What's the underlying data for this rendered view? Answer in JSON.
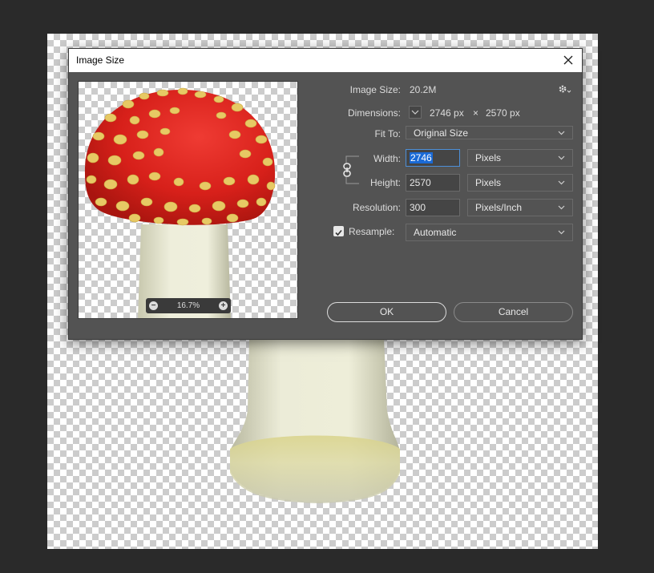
{
  "dialog": {
    "title": "Image Size",
    "image_size_label": "Image Size:",
    "image_size_value": "20.2M",
    "dimensions_label": "Dimensions:",
    "dimensions_width": "2746 px",
    "dimensions_times": "×",
    "dimensions_height": "2570 px",
    "fit_to_label": "Fit To:",
    "fit_to_value": "Original Size",
    "width_label": "Width:",
    "width_value": "2746",
    "width_unit": "Pixels",
    "height_label": "Height:",
    "height_value": "2570",
    "height_unit": "Pixels",
    "resolution_label": "Resolution:",
    "resolution_value": "300",
    "resolution_unit": "Pixels/Inch",
    "resample_label": "Resample:",
    "resample_checked": true,
    "resample_value": "Automatic",
    "ok_label": "OK",
    "cancel_label": "Cancel",
    "zoom_value": "16.7%",
    "zoom_out_glyph": "−",
    "zoom_in_glyph": "+"
  },
  "icons": {
    "close": "close-icon",
    "settings": "gear-icon",
    "link": "chain-link-icon",
    "chevron": "chevron-down-icon"
  },
  "colors": {
    "cap_red": "#d7201a",
    "cap_spots": "#e7c964",
    "stem": "#e9e9d3",
    "selection": "#1a6ad6"
  }
}
